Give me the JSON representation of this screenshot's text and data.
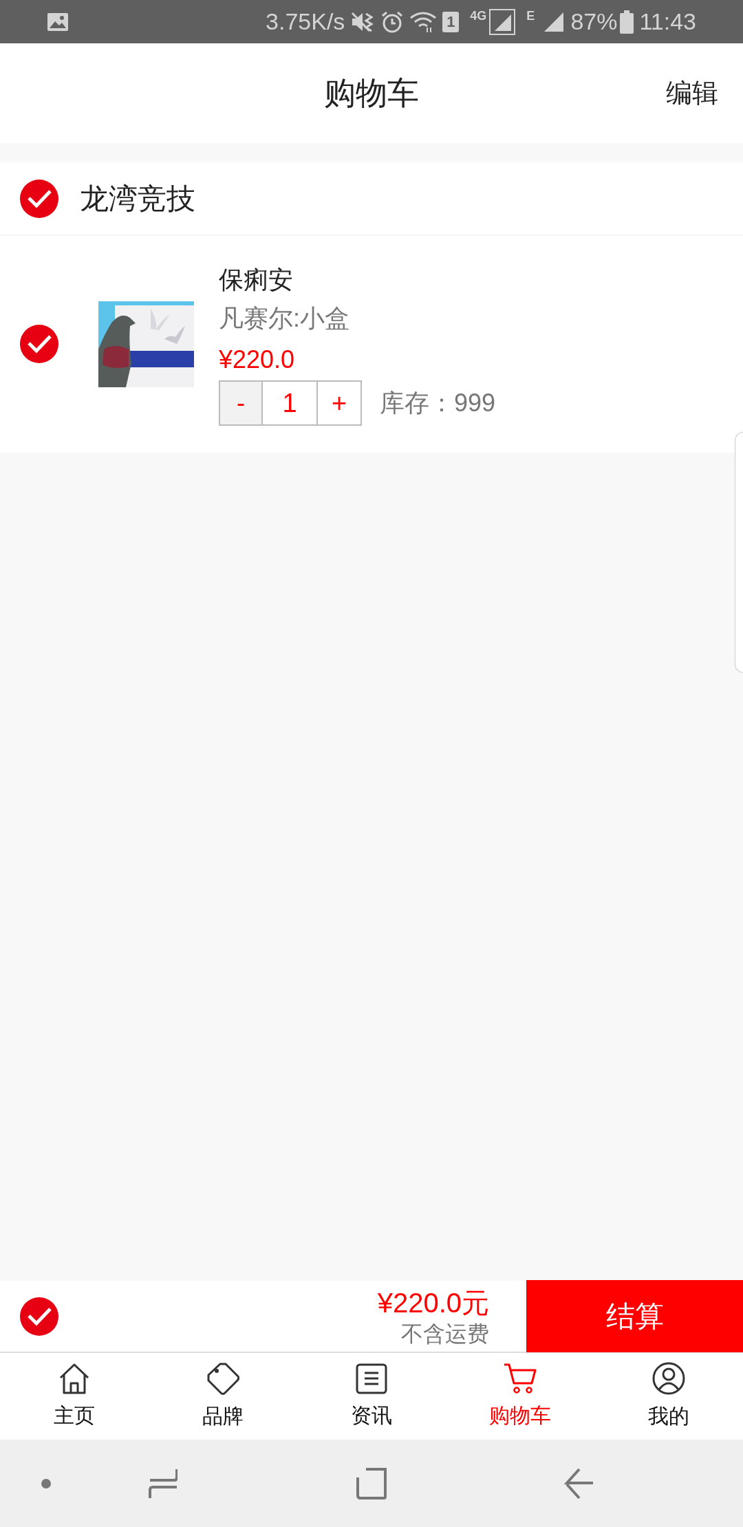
{
  "status_bar": {
    "speed": "3.75K/s",
    "sim": "1",
    "network": "4G",
    "network_2": "E",
    "battery": "87%",
    "time": "11:43"
  },
  "header": {
    "title": "购物车",
    "action": "编辑"
  },
  "stores": [
    {
      "name": "龙湾竞技",
      "checked": true,
      "items": [
        {
          "name": "保痢安",
          "variant": "凡赛尔:小盒",
          "price": "¥220.0",
          "quantity": "1",
          "minus": "-",
          "plus": "+",
          "stock": "库存：999",
          "checked": true
        }
      ]
    }
  ],
  "footer": {
    "checked": true,
    "total": "¥220.0元",
    "note": "不含运费",
    "checkout": "结算"
  },
  "tabs": [
    {
      "label": "主页",
      "kind": "home",
      "selected": false
    },
    {
      "label": "品牌",
      "kind": "tag",
      "selected": false
    },
    {
      "label": "资讯",
      "kind": "news",
      "selected": false
    },
    {
      "label": "购物车",
      "kind": "cart",
      "selected": true
    },
    {
      "label": "我的",
      "kind": "user",
      "selected": false
    }
  ]
}
